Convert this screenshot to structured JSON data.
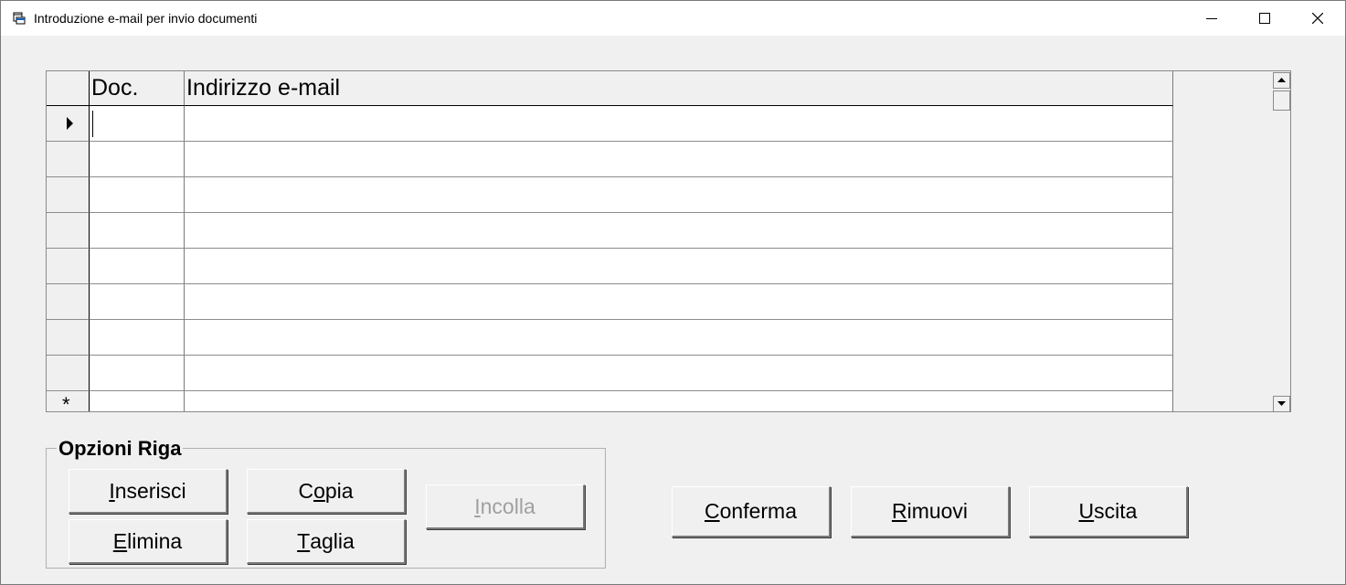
{
  "window": {
    "title": "Introduzione e-mail per invio documenti"
  },
  "grid": {
    "columns": [
      "Doc.",
      "Indirizzo e-mail"
    ],
    "rows": [
      {
        "doc": "",
        "email": ""
      },
      {
        "doc": "",
        "email": ""
      },
      {
        "doc": "",
        "email": ""
      },
      {
        "doc": "",
        "email": ""
      },
      {
        "doc": "",
        "email": ""
      },
      {
        "doc": "",
        "email": ""
      },
      {
        "doc": "",
        "email": ""
      },
      {
        "doc": "",
        "email": ""
      }
    ],
    "new_row_marker": "*"
  },
  "row_options": {
    "label": "Opzioni Riga",
    "buttons": [
      {
        "id": "inserisci",
        "pre": "",
        "key": "I",
        "post": "nserisci",
        "enabled": true
      },
      {
        "id": "copia",
        "pre": "C",
        "key": "o",
        "post": "pia",
        "enabled": true
      },
      {
        "id": "incolla",
        "pre": "",
        "key": "I",
        "post": "ncolla",
        "enabled": false
      },
      {
        "id": "elimina",
        "pre": "",
        "key": "E",
        "post": "limina",
        "enabled": true
      },
      {
        "id": "taglia",
        "pre": "",
        "key": "T",
        "post": "aglia",
        "enabled": true
      }
    ]
  },
  "actions": {
    "buttons": [
      {
        "id": "conferma",
        "pre": "",
        "key": "C",
        "post": "onferma",
        "enabled": true
      },
      {
        "id": "rimuovi",
        "pre": "",
        "key": "R",
        "post": "imuovi",
        "enabled": true
      },
      {
        "id": "uscita",
        "pre": "",
        "key": "U",
        "post": "scita",
        "enabled": true
      }
    ]
  }
}
